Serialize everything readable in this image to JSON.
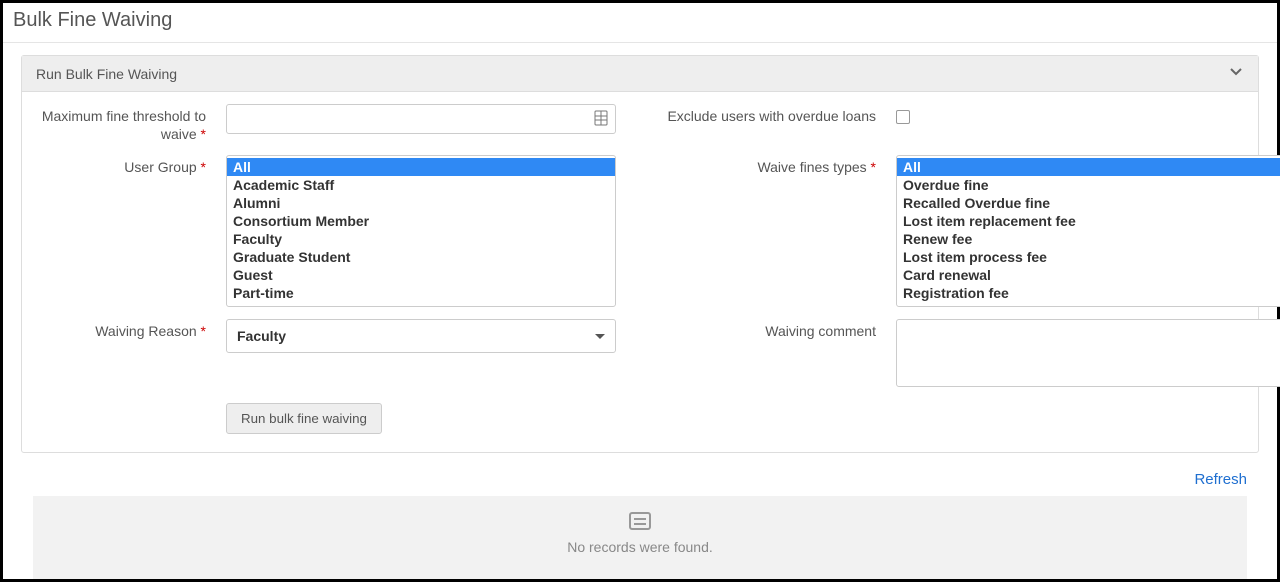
{
  "page": {
    "title": "Bulk Fine Waiving"
  },
  "panel": {
    "title": "Run Bulk Fine Waiving"
  },
  "labels": {
    "max_fine": "Maximum fine threshold to waive",
    "exclude_overdue": "Exclude users with overdue loans",
    "user_group": "User Group",
    "waive_types": "Waive fines types",
    "waiving_reason": "Waiving Reason",
    "waiving_comment": "Waiving comment"
  },
  "form": {
    "max_fine_value": "",
    "exclude_overdue_checked": false,
    "user_group_options": [
      {
        "label": "All",
        "selected": true
      },
      {
        "label": "Academic Staff",
        "selected": false
      },
      {
        "label": "Alumni",
        "selected": false
      },
      {
        "label": "Consortium Member",
        "selected": false
      },
      {
        "label": "Faculty",
        "selected": false
      },
      {
        "label": "Graduate Student",
        "selected": false
      },
      {
        "label": "Guest",
        "selected": false
      },
      {
        "label": "Part-time",
        "selected": false
      }
    ],
    "waive_type_options": [
      {
        "label": "All",
        "selected": true
      },
      {
        "label": "Overdue fine",
        "selected": false
      },
      {
        "label": "Recalled Overdue fine",
        "selected": false
      },
      {
        "label": "Lost item replacement fee",
        "selected": false
      },
      {
        "label": "Renew fee",
        "selected": false
      },
      {
        "label": "Lost item process fee",
        "selected": false
      },
      {
        "label": "Card renewal",
        "selected": false
      },
      {
        "label": "Registration fee",
        "selected": false
      }
    ],
    "waiving_reason_selected": "Faculty",
    "waiving_comment_value": ""
  },
  "buttons": {
    "run": "Run bulk fine waiving",
    "refresh": "Refresh"
  },
  "empty_state": {
    "text": "No records were found."
  },
  "required_mark": "*"
}
